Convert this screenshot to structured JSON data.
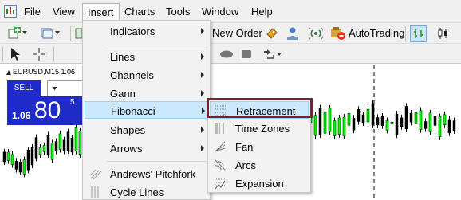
{
  "menubar": {
    "items": [
      {
        "label": "File"
      },
      {
        "label": "View"
      },
      {
        "label": "Insert"
      },
      {
        "label": "Charts"
      },
      {
        "label": "Tools"
      },
      {
        "label": "Window"
      },
      {
        "label": "Help"
      }
    ]
  },
  "toolbar": {
    "new_order_label": "New Order",
    "autotrading_label": "AutoTrading"
  },
  "chart": {
    "title": "EURUSD,M15  1.06",
    "one_click": {
      "sell_label": "SELL",
      "price_prefix": "1.06",
      "price_main": "80",
      "price_sup": "5"
    }
  },
  "insert_menu": {
    "items": [
      {
        "label": "Indicators",
        "has_submenu": true
      },
      {
        "label": "Lines",
        "has_submenu": true
      },
      {
        "label": "Channels",
        "has_submenu": true
      },
      {
        "label": "Gann",
        "has_submenu": true
      },
      {
        "label": "Fibonacci",
        "has_submenu": true,
        "highlighted": true
      },
      {
        "label": "Shapes",
        "has_submenu": true
      },
      {
        "label": "Arrows",
        "has_submenu": true
      },
      {
        "label": "Andrews' Pitchfork",
        "has_submenu": false
      },
      {
        "label": "Cycle Lines",
        "has_submenu": false
      }
    ]
  },
  "fibonacci_submenu": {
    "items": [
      {
        "label": "Retracement",
        "highlighted": true,
        "icon": "fibo-retracement-icon"
      },
      {
        "label": "Time Zones",
        "icon": "fibo-timezones-icon"
      },
      {
        "label": "Fan",
        "icon": "fibo-fan-icon"
      },
      {
        "label": "Arcs",
        "icon": "fibo-arcs-icon"
      },
      {
        "label": "Expansion",
        "icon": "fibo-expansion-icon"
      }
    ]
  },
  "colors": {
    "accent_blue": "#1e2bc8",
    "menu_highlight": "#cce8ff",
    "focus_outline": "#7d1f2e",
    "candle_bull": "#00ff00",
    "candle_bear": "#000000"
  }
}
